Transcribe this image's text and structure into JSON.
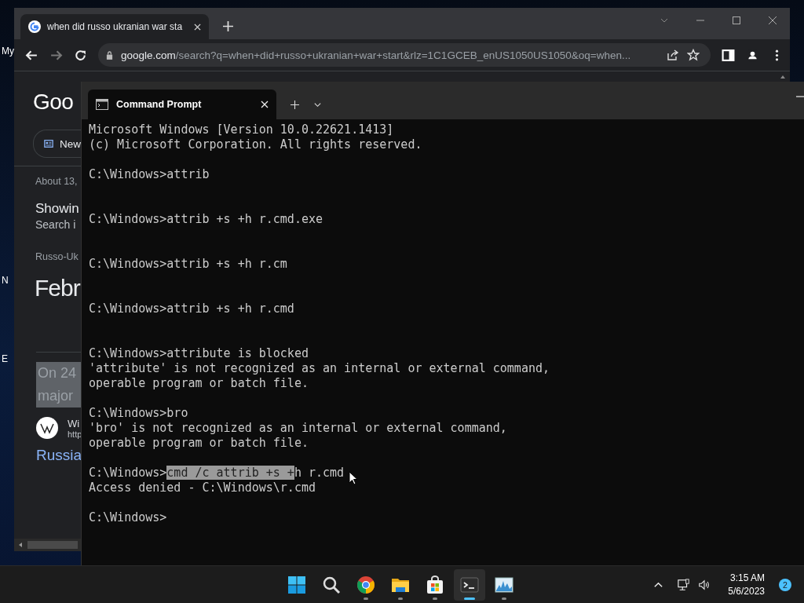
{
  "desktop": {
    "icon_labels": [
      "My",
      "N",
      "E"
    ]
  },
  "browser": {
    "tab": {
      "title": "when did russo ukranian war sta",
      "selected": true
    },
    "address": {
      "host": "google.com",
      "path": "/search?q=when+did+russo+ukranian+war+start&rlz=1C1GCEB_enUS1050US1050&oq=when..."
    },
    "page": {
      "logo": "Goo",
      "chip": "New",
      "result_count": "About 13,",
      "showing": "Showin",
      "search_instead": "Search i",
      "breadcrumb": "Russo-Uk",
      "answer": "Febr",
      "snippet": [
        {
          "text": "On 24",
          "highlighted": true
        },
        {
          "text": "major",
          "highlighted": true
        }
      ],
      "source_name": "Wi",
      "source_url": "http",
      "link": "Russia"
    }
  },
  "terminal": {
    "tab": {
      "title": "Command Prompt",
      "selected": true
    },
    "blocks": [
      {
        "extra_blank_line": false,
        "lines": [
          {
            "text": "Microsoft Windows [Version 10.0.22621.1413]"
          },
          {
            "text": "(c) Microsoft Corporation. All rights reserved."
          }
        ]
      },
      {
        "extra_blank_line": true,
        "lines": [
          {
            "text": "C:\\Windows>attrib"
          }
        ]
      },
      {
        "extra_blank_line": true,
        "lines": [
          {
            "text": "C:\\Windows>attrib +s +h r.cmd.exe"
          }
        ]
      },
      {
        "extra_blank_line": true,
        "lines": [
          {
            "text": "C:\\Windows>attrib +s +h r.cm"
          }
        ]
      },
      {
        "extra_blank_line": true,
        "lines": [
          {
            "text": "C:\\Windows>attrib +s +h r.cmd"
          }
        ]
      },
      {
        "extra_blank_line": false,
        "lines": [
          {
            "text": "C:\\Windows>attribute is blocked"
          },
          {
            "text": "'attribute' is not recognized as an internal or external command,"
          },
          {
            "text": "operable program or batch file."
          }
        ]
      },
      {
        "extra_blank_line": false,
        "lines": [
          {
            "text": "C:\\Windows>bro"
          },
          {
            "text": "'bro' is not recognized as an internal or external command,"
          },
          {
            "text": "operable program or batch file."
          }
        ]
      },
      {
        "extra_blank_line": false,
        "lines": [
          {
            "segments": [
              {
                "text": "C:\\Windows>",
                "selected": false
              },
              {
                "text": "cmd /c attrib +s +",
                "selected": true
              },
              {
                "text": "h r.cmd",
                "selected": false
              }
            ]
          },
          {
            "text": "Access denied - C:\\Windows\\r.cmd"
          }
        ]
      },
      {
        "extra_blank_line": false,
        "lines": [
          {
            "text": "C:\\Windows>"
          }
        ]
      }
    ]
  },
  "taskbar": {
    "apps": [
      {
        "kind": "start",
        "running": false,
        "selected": false
      },
      {
        "kind": "search",
        "running": false,
        "selected": false
      },
      {
        "kind": "chrome",
        "running": true,
        "selected": false
      },
      {
        "kind": "explorer",
        "running": true,
        "selected": false
      },
      {
        "kind": "store",
        "running": true,
        "selected": false
      },
      {
        "kind": "terminal",
        "running": true,
        "selected": true
      },
      {
        "kind": "monitor",
        "running": true,
        "selected": false
      }
    ],
    "time": "3:15 AM",
    "date": "5/6/2023",
    "notifications": "2"
  }
}
